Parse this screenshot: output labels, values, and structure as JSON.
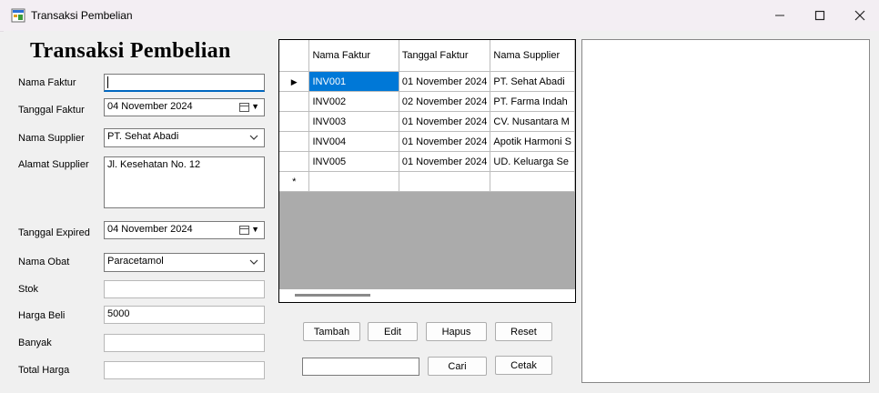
{
  "window": {
    "title": "Transaksi Pembelian",
    "minimize": "—",
    "maximize": "☐",
    "close": "✕"
  },
  "form": {
    "heading": "Transaksi Pembelian",
    "labels": {
      "nama_faktur": "Nama Faktur",
      "tanggal_faktur": "Tanggal Faktur",
      "nama_supplier": "Nama Supplier",
      "alamat_supplier": "Alamat Supplier",
      "tanggal_expired": "Tanggal Expired",
      "nama_obat": "Nama Obat",
      "stok": "Stok",
      "harga_beli": "Harga Beli",
      "banyak": "Banyak",
      "total_harga": "Total Harga"
    },
    "values": {
      "nama_faktur": "",
      "tanggal_faktur": "04 November 2024",
      "nama_supplier": "PT. Sehat Abadi",
      "alamat_supplier": "Jl. Kesehatan No. 12",
      "tanggal_expired": "04 November 2024",
      "nama_obat": "Paracetamol",
      "stok": "",
      "harga_beli": "5000",
      "banyak": "",
      "total_harga": ""
    }
  },
  "grid": {
    "columns": [
      {
        "label": "Nama Faktur"
      },
      {
        "label": "Tanggal Faktur"
      },
      {
        "label": "Nama Supplier"
      }
    ],
    "rows": [
      [
        "INV001",
        "01 November 2024",
        "PT. Sehat Abadi"
      ],
      [
        "INV002",
        "02 November 2024",
        "PT. Farma Indah"
      ],
      [
        "INV003",
        "01 November 2024",
        "CV. Nusantara M"
      ],
      [
        "INV004",
        "01 November 2024",
        "Apotik Harmoni S"
      ],
      [
        "INV005",
        "01 November 2024",
        "UD. Keluarga Se"
      ]
    ],
    "current_row_marker": "▶",
    "new_row_marker": "*"
  },
  "buttons": {
    "tambah": "Tambah",
    "edit": "Edit",
    "hapus": "Hapus",
    "reset": "Reset",
    "cari": "Cari",
    "cetak": "Cetak"
  },
  "search": {
    "value": ""
  },
  "colors": {
    "selection": "#0078d7",
    "grid_background": "#ababab",
    "focus_border": "#0067c0"
  }
}
